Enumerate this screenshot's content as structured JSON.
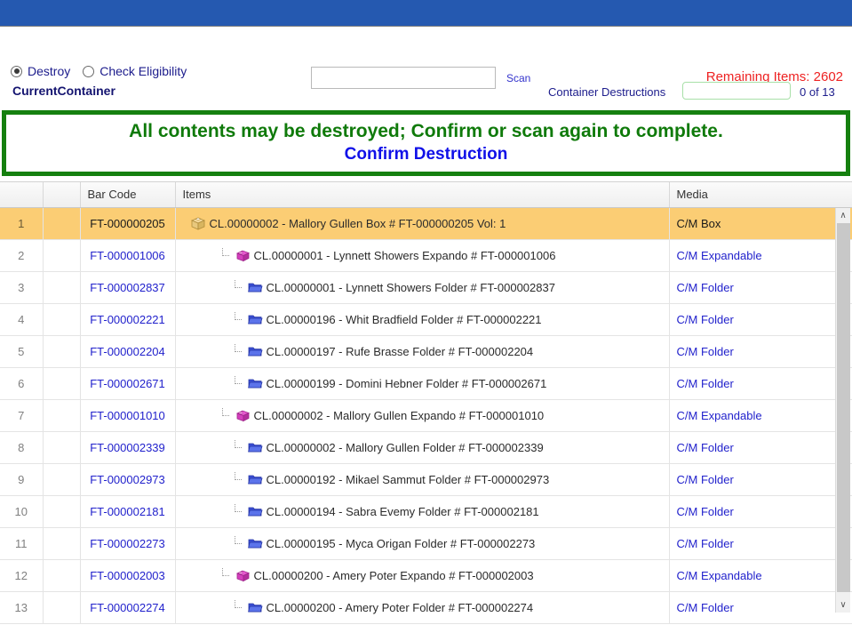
{
  "top_bar": {
    "color": "#2559b0"
  },
  "toolbar": {
    "radios": [
      {
        "label": "Destroy",
        "selected": true
      },
      {
        "label": "Check Eligibility",
        "selected": false
      }
    ],
    "scan_input_value": "",
    "scan_input_placeholder": "",
    "scan_link_label": "Scan",
    "remaining_items_label": "Remaining Items: 2602",
    "remaining_items_count": 2602,
    "remaining_items_color": "#ee2222"
  },
  "container_row": {
    "current_container_label": "CurrentContainer",
    "destructions_label": "Container Destructions",
    "destructions_input_value": "",
    "destructions_count_label": "0 of 13",
    "destructions_done": 0,
    "destructions_total": 13
  },
  "banner": {
    "message": "All contents may be destroyed; Confirm or scan again to complete.",
    "action_label": "Confirm Destruction",
    "message_color": "#0f7a0a",
    "action_color": "#1010e8",
    "border_color": "#15800f"
  },
  "grid": {
    "columns": [
      "",
      "",
      "Bar Code",
      "Items",
      "Media"
    ],
    "rows": [
      {
        "num": "1",
        "bar_code": "FT-000000205",
        "item": "CL.00000002 - Mallory Gullen Box # FT-000000205 Vol: 1",
        "media": "C/M Box",
        "icon": "box-icon",
        "level": 0,
        "selected": true
      },
      {
        "num": "2",
        "bar_code": "FT-000001006",
        "item": "CL.00000001 - Lynnett Showers Expando # FT-000001006",
        "media": "C/M Expandable",
        "icon": "expando-icon",
        "level": 1,
        "selected": false
      },
      {
        "num": "3",
        "bar_code": "FT-000002837",
        "item": "CL.00000001 - Lynnett Showers Folder # FT-000002837",
        "media": "C/M Folder",
        "icon": "folder-icon",
        "level": 2,
        "selected": false
      },
      {
        "num": "4",
        "bar_code": "FT-000002221",
        "item": "CL.00000196 - Whit Bradfield Folder # FT-000002221",
        "media": "C/M Folder",
        "icon": "folder-icon",
        "level": 2,
        "selected": false
      },
      {
        "num": "5",
        "bar_code": "FT-000002204",
        "item": "CL.00000197 - Rufe Brasse Folder # FT-000002204",
        "media": "C/M Folder",
        "icon": "folder-icon",
        "level": 2,
        "selected": false
      },
      {
        "num": "6",
        "bar_code": "FT-000002671",
        "item": "CL.00000199 - Domini Hebner Folder # FT-000002671",
        "media": "C/M Folder",
        "icon": "folder-icon",
        "level": 2,
        "selected": false
      },
      {
        "num": "7",
        "bar_code": "FT-000001010",
        "item": "CL.00000002 - Mallory Gullen Expando # FT-000001010",
        "media": "C/M Expandable",
        "icon": "expando-icon",
        "level": 1,
        "selected": false
      },
      {
        "num": "8",
        "bar_code": "FT-000002339",
        "item": "CL.00000002 - Mallory Gullen Folder # FT-000002339",
        "media": "C/M Folder",
        "icon": "folder-icon",
        "level": 2,
        "selected": false
      },
      {
        "num": "9",
        "bar_code": "FT-000002973",
        "item": "CL.00000192 - Mikael Sammut Folder # FT-000002973",
        "media": "C/M Folder",
        "icon": "folder-icon",
        "level": 2,
        "selected": false
      },
      {
        "num": "10",
        "bar_code": "FT-000002181",
        "item": "CL.00000194 - Sabra Evemy Folder # FT-000002181",
        "media": "C/M Folder",
        "icon": "folder-icon",
        "level": 2,
        "selected": false
      },
      {
        "num": "11",
        "bar_code": "FT-000002273",
        "item": "CL.00000195 - Myca Origan Folder # FT-000002273",
        "media": "C/M Folder",
        "icon": "folder-icon",
        "level": 2,
        "selected": false
      },
      {
        "num": "12",
        "bar_code": "FT-000002003",
        "item": "CL.00000200 - Amery Poter Expando # FT-000002003",
        "media": "C/M Expandable",
        "icon": "expando-icon",
        "level": 1,
        "selected": false
      },
      {
        "num": "13",
        "bar_code": "FT-000002274",
        "item": "CL.00000200 - Amery Poter Folder # FT-000002274",
        "media": "C/M Folder",
        "icon": "folder-icon",
        "level": 2,
        "selected": false
      }
    ]
  },
  "scrollbar": {
    "up_glyph": "∧",
    "down_glyph": "∨"
  }
}
